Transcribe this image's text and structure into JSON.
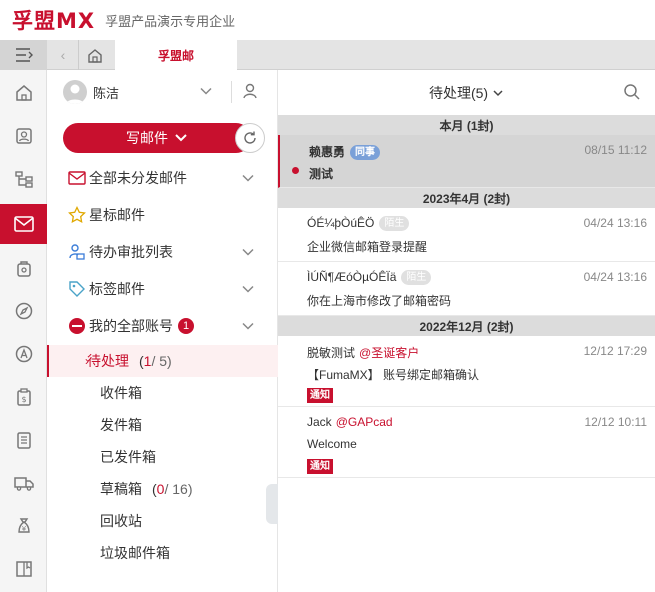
{
  "header": {
    "logo": "孚盟MX",
    "company": "孚盟产品演示专用企业"
  },
  "tabs": {
    "active_label": "孚盟邮"
  },
  "rail": {
    "items": [
      "home-icon",
      "contact-icon",
      "org-tree-icon",
      "mail-icon",
      "bag-icon",
      "compass-icon",
      "a-circle-icon",
      "clipboard-dollar-icon",
      "document-list-icon",
      "truck-icon",
      "money-bag-icon",
      "book-icon"
    ]
  },
  "user": {
    "name": "陈洁"
  },
  "compose": {
    "label": "写邮件"
  },
  "nav": {
    "items": [
      {
        "label": "全部未分发邮件",
        "icon": "unsorted-mail-icon",
        "chevron": true
      },
      {
        "label": "星标邮件",
        "icon": "star-icon",
        "chevron": false
      },
      {
        "label": "待办审批列表",
        "icon": "approval-icon",
        "chevron": true
      },
      {
        "label": "标签邮件",
        "icon": "tag-icon",
        "chevron": true
      },
      {
        "label": "我的全部账号",
        "icon": "account-icon",
        "chevron": true,
        "badge": "1"
      }
    ]
  },
  "folders": [
    {
      "label": "待处理",
      "active": true,
      "current": "1",
      "total": " 5"
    },
    {
      "label": "收件箱"
    },
    {
      "label": "发件箱"
    },
    {
      "label": "已发件箱"
    },
    {
      "label": "草稿箱",
      "current": "0",
      "total": " 16"
    },
    {
      "label": "回收站"
    },
    {
      "label": "垃圾邮件箱"
    }
  ],
  "list": {
    "title": "待处理(5)",
    "sections": [
      {
        "label": "本月 (1封)"
      },
      {
        "label": "2023年4月 (2封)"
      },
      {
        "label": "2022年12月 (2封)"
      }
    ],
    "messages": [
      {
        "sender": "赖惠勇",
        "tag": "同事",
        "date": "08/15 11:12",
        "subject": "测试"
      },
      {
        "sender": "ÓÉ¼þÒúÊÖ",
        "tag": "陌生",
        "date": "04/24 13:16",
        "subject": "企业微信邮箱登录提醒"
      },
      {
        "sender": "ÌÚÑ¶ÆóÒµÓÊÏä",
        "tag": "陌生",
        "date": "04/24 13:16",
        "subject": "你在上海市修改了邮箱密码"
      },
      {
        "sender": "脱敏测试",
        "domain": "@圣诞客户",
        "date": "12/12 17:29",
        "subject": "【FumaMX】 账号绑定邮箱确认",
        "notice": "通知"
      },
      {
        "sender": "Jack",
        "domain": "@GAPcad",
        "date": "12/12 10:11",
        "subject": "Welcome",
        "notice": "通知"
      }
    ]
  },
  "colors": {
    "brand": "#c8102e",
    "colleague_tag": "#7aa0d8"
  }
}
